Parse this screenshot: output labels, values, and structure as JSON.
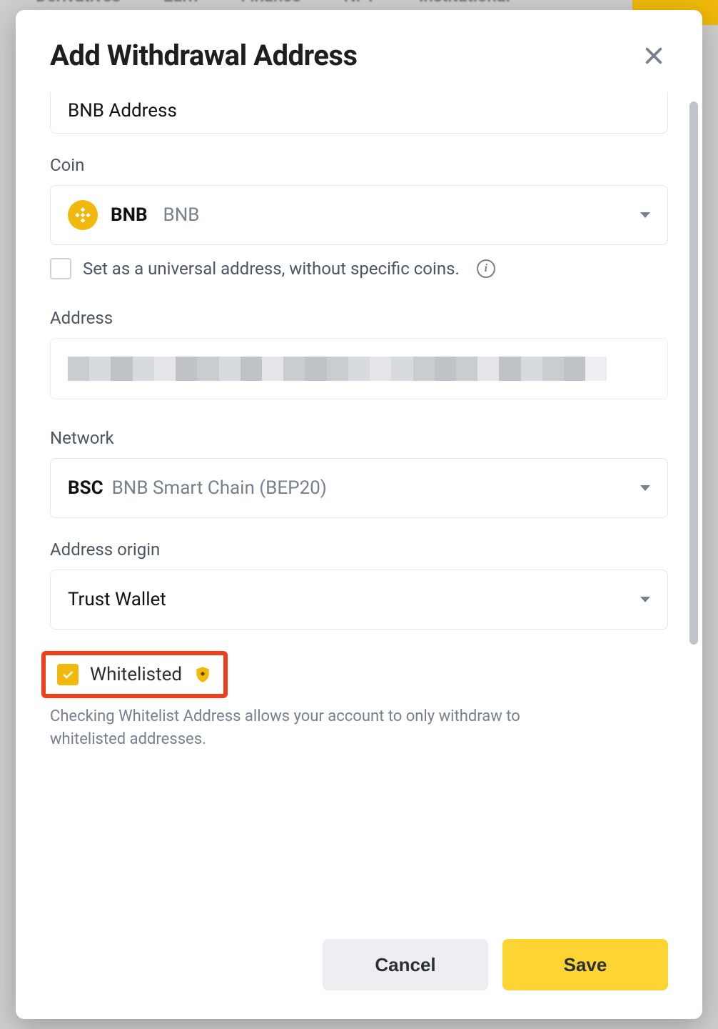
{
  "bgNav": [
    "Derivatives",
    "Earn",
    "Finance",
    "NFT",
    "Institutional"
  ],
  "modal": {
    "title": "Add Withdrawal Address",
    "labelInput": {
      "value": "BNB Address"
    },
    "coin": {
      "label": "Coin",
      "symbol": "BNB",
      "name": "BNB"
    },
    "universal": {
      "checked": false,
      "label": "Set as a universal address, without specific coins."
    },
    "address": {
      "label": "Address"
    },
    "network": {
      "label": "Network",
      "symbol": "BSC",
      "name": "BNB Smart Chain (BEP20)"
    },
    "origin": {
      "label": "Address origin",
      "value": "Trust Wallet"
    },
    "whitelist": {
      "checked": true,
      "label": "Whitelisted",
      "desc": "Checking Whitelist Address allows your account to only withdraw to whitelisted addresses."
    },
    "buttons": {
      "cancel": "Cancel",
      "save": "Save"
    }
  }
}
